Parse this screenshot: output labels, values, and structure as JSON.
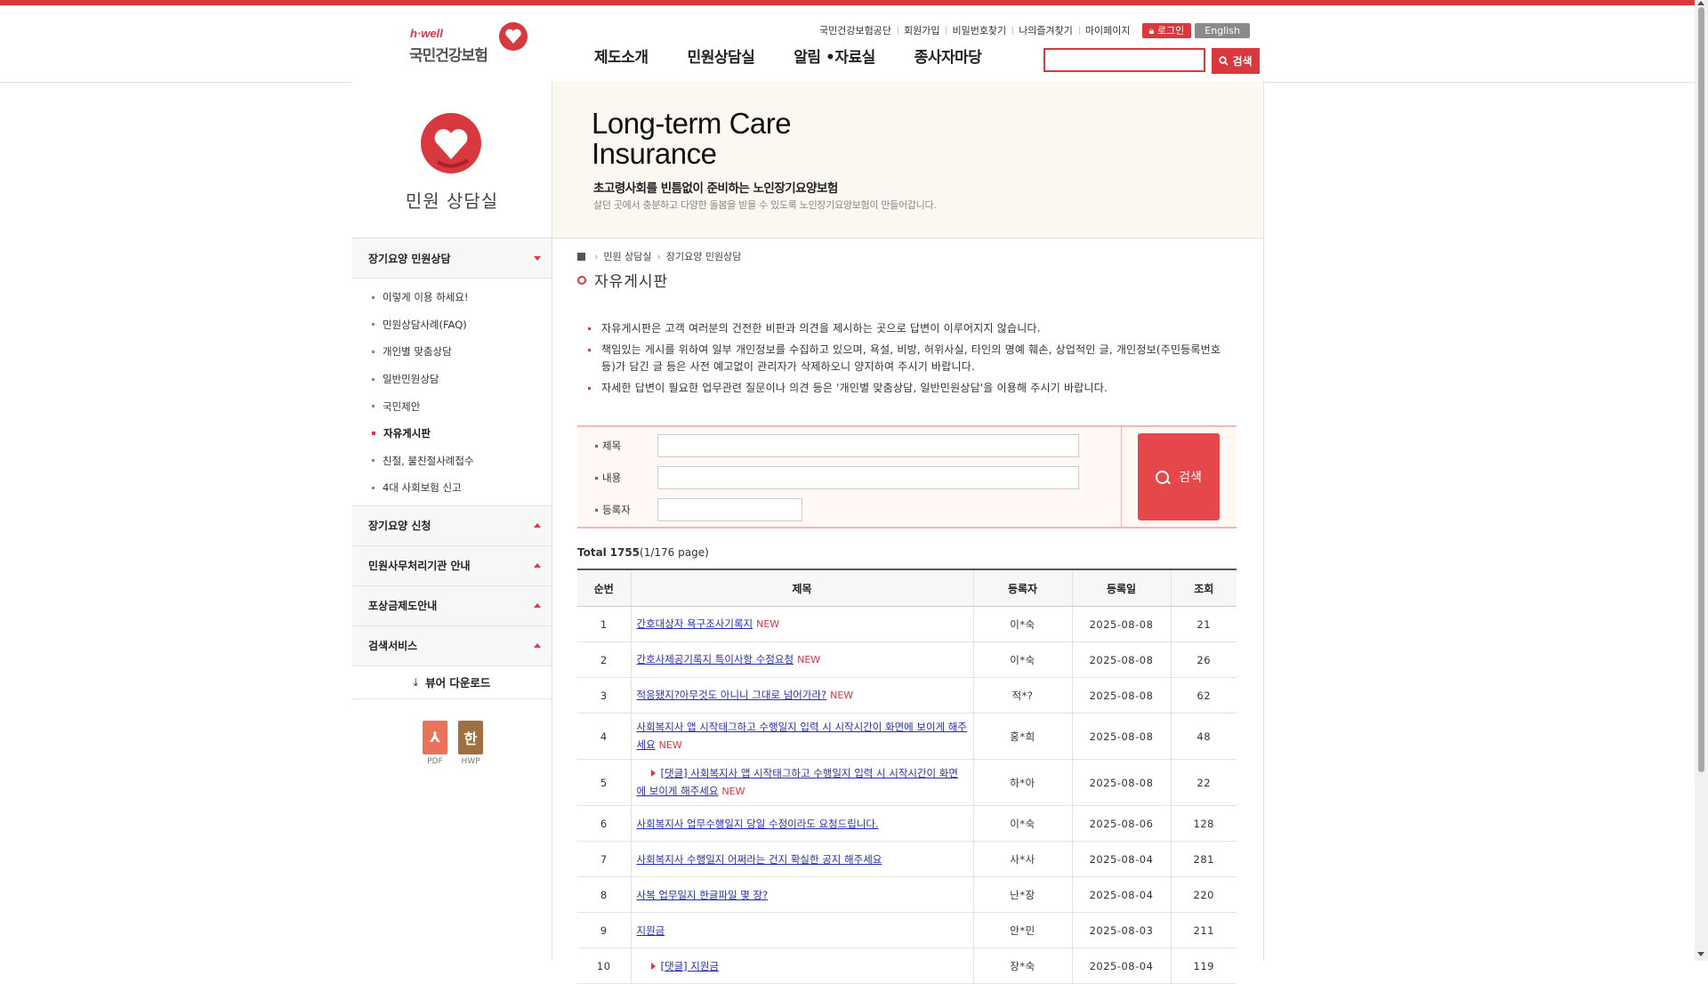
{
  "brand": {
    "logo_en": "h·well",
    "logo_ko": "국민건강보험",
    "accent": "#d7393f"
  },
  "util_links": [
    "국민건강보험공단",
    "회원가입",
    "비밀번호찾기",
    "나의즐겨찾기",
    "마이페이지"
  ],
  "login_label": "로그인",
  "english_label": "English",
  "gnb": [
    "제도소개",
    "민원상담실",
    "알림 •자료실",
    "종사자마당"
  ],
  "header_search": {
    "value": "",
    "button": "검색"
  },
  "lnb": {
    "title": "민원 상담실",
    "sections": [
      {
        "label": "장기요양 민원상담",
        "expanded": true,
        "items": [
          "이렇게 이용 하세요!",
          "민원상담사례(FAQ)",
          "개인별 맞춤상담",
          "일반민원상담",
          "국민제안",
          "자유게시판",
          "친절, 불친절사례접수",
          "4대 사회보험 신고"
        ],
        "active_index": 5
      },
      {
        "label": "장기요양 신청",
        "expanded": false
      },
      {
        "label": "민원사무처리기관 안내",
        "expanded": false
      },
      {
        "label": "포상금제도안내",
        "expanded": false
      },
      {
        "label": "검색서비스",
        "expanded": false
      }
    ],
    "viewer_label": "뷰어 다운로드",
    "viewer_arrow": "⤓",
    "downloads": [
      {
        "label": "PDF",
        "glyph": "⅄",
        "color": "#e8735a"
      },
      {
        "label": "HWP",
        "glyph": "한",
        "color": "#a07040"
      }
    ]
  },
  "banner": {
    "title_line1": "Long-term Care",
    "title_line2": "Insurance",
    "subtitle": "초고령사회를 빈틈없이 준비하는 노인장기요양보험",
    "desc": "살던 곳에서 충분하고 다양한 돌봄을 받을 수 있도록 노인장기요양보험이 만들어갑니다."
  },
  "breadcrumb": [
    "민원 상담실",
    "장기요양 민원상담"
  ],
  "page_title": "자유게시판",
  "notices": [
    "자유게시판은 고객 여러분의 건전한 비판과 의견을 제시하는 곳으로 답변이 이루어지지 않습니다.",
    "책임있는 게시를 위하여 일부 개인정보를 수집하고 있으며, 욕설, 비방, 허위사실, 타인의 명예 훼손, 상업적인 글, 개인정보(주민등록번호 등)가 담긴 글 등은 사전 예고없이 관리자가 삭제하오니 양지하여 주시기 바랍니다.",
    "자세한 답변이 필요한 업무관련 질문이나 의견 등은 '개인별 맞춤상담, 일반민원상담'을 이용해 주시기 바랍니다."
  ],
  "search_form": {
    "labels": [
      "제목",
      "내용",
      "등록자"
    ],
    "values": [
      "",
      "",
      ""
    ],
    "button": "검색"
  },
  "total": {
    "label": "Total",
    "count": "1755",
    "pages": "(1/176 page)"
  },
  "table": {
    "headers": [
      "순번",
      "제목",
      "등록자",
      "등록일",
      "조회"
    ],
    "new_label": "NEW",
    "rows": [
      {
        "no": "1",
        "title": "간호대상자 욕구조사기록지",
        "is_new": true,
        "reply": false,
        "author": "이*숙",
        "date": "2025-08-08",
        "views": "21"
      },
      {
        "no": "2",
        "title": "간호사제공기록지 특이사항 수정요청",
        "is_new": true,
        "reply": false,
        "author": "이*숙",
        "date": "2025-08-08",
        "views": "26"
      },
      {
        "no": "3",
        "title": "적응됐지?아무것도 아니니 그대로 넘어가라?",
        "is_new": true,
        "reply": false,
        "author": "적*?",
        "date": "2025-08-08",
        "views": "62"
      },
      {
        "no": "4",
        "title": "사회복지사 앱 시작태그하고 수행일지 입력 시 시작시간이 화면에 보이게 해주세요",
        "is_new": true,
        "reply": false,
        "author": "홍*희",
        "date": "2025-08-08",
        "views": "48"
      },
      {
        "no": "5",
        "title": "[댓글] 사회복지사 앱 시작태그하고 수행일지 입력 시 시작시간이 화면에 보이게 해주세요",
        "is_new": true,
        "reply": true,
        "author": "하*아",
        "date": "2025-08-08",
        "views": "22"
      },
      {
        "no": "6",
        "title": "사회복지사 업무수행일지 당일 수정이라도 요청드립니다.",
        "is_new": false,
        "reply": false,
        "author": "이*숙",
        "date": "2025-08-06",
        "views": "128"
      },
      {
        "no": "7",
        "title": "사회복지사 수행일지 어쩌라는 건지 확실한 공지 해주세요",
        "is_new": false,
        "reply": false,
        "author": "사*사",
        "date": "2025-08-04",
        "views": "281"
      },
      {
        "no": "8",
        "title": "사복 업무일지 한글파일 몇 장?",
        "is_new": false,
        "reply": false,
        "author": "난*장",
        "date": "2025-08-04",
        "views": "220"
      },
      {
        "no": "9",
        "title": "지원금",
        "is_new": false,
        "reply": false,
        "author": "안*민",
        "date": "2025-08-03",
        "views": "211"
      },
      {
        "no": "10",
        "title": "[댓글] 지원금",
        "is_new": false,
        "reply": true,
        "author": "장*숙",
        "date": "2025-08-04",
        "views": "119"
      }
    ]
  }
}
